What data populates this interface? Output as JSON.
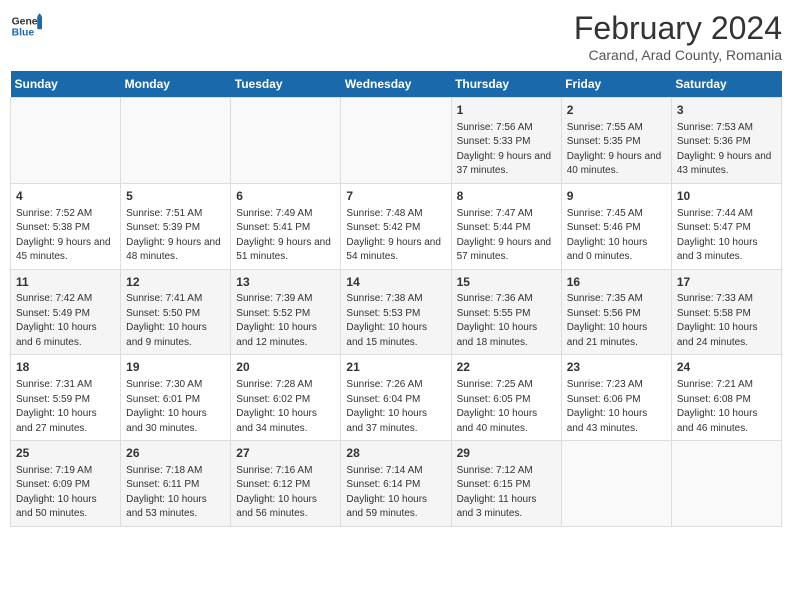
{
  "logo": {
    "general": "General",
    "blue": "Blue"
  },
  "title": "February 2024",
  "subtitle": "Carand, Arad County, Romania",
  "days_of_week": [
    "Sunday",
    "Monday",
    "Tuesday",
    "Wednesday",
    "Thursday",
    "Friday",
    "Saturday"
  ],
  "weeks": [
    [
      {
        "day": "",
        "sunrise": "",
        "sunset": "",
        "daylight": ""
      },
      {
        "day": "",
        "sunrise": "",
        "sunset": "",
        "daylight": ""
      },
      {
        "day": "",
        "sunrise": "",
        "sunset": "",
        "daylight": ""
      },
      {
        "day": "",
        "sunrise": "",
        "sunset": "",
        "daylight": ""
      },
      {
        "day": "1",
        "sunrise": "Sunrise: 7:56 AM",
        "sunset": "Sunset: 5:33 PM",
        "daylight": "Daylight: 9 hours and 37 minutes."
      },
      {
        "day": "2",
        "sunrise": "Sunrise: 7:55 AM",
        "sunset": "Sunset: 5:35 PM",
        "daylight": "Daylight: 9 hours and 40 minutes."
      },
      {
        "day": "3",
        "sunrise": "Sunrise: 7:53 AM",
        "sunset": "Sunset: 5:36 PM",
        "daylight": "Daylight: 9 hours and 43 minutes."
      }
    ],
    [
      {
        "day": "4",
        "sunrise": "Sunrise: 7:52 AM",
        "sunset": "Sunset: 5:38 PM",
        "daylight": "Daylight: 9 hours and 45 minutes."
      },
      {
        "day": "5",
        "sunrise": "Sunrise: 7:51 AM",
        "sunset": "Sunset: 5:39 PM",
        "daylight": "Daylight: 9 hours and 48 minutes."
      },
      {
        "day": "6",
        "sunrise": "Sunrise: 7:49 AM",
        "sunset": "Sunset: 5:41 PM",
        "daylight": "Daylight: 9 hours and 51 minutes."
      },
      {
        "day": "7",
        "sunrise": "Sunrise: 7:48 AM",
        "sunset": "Sunset: 5:42 PM",
        "daylight": "Daylight: 9 hours and 54 minutes."
      },
      {
        "day": "8",
        "sunrise": "Sunrise: 7:47 AM",
        "sunset": "Sunset: 5:44 PM",
        "daylight": "Daylight: 9 hours and 57 minutes."
      },
      {
        "day": "9",
        "sunrise": "Sunrise: 7:45 AM",
        "sunset": "Sunset: 5:46 PM",
        "daylight": "Daylight: 10 hours and 0 minutes."
      },
      {
        "day": "10",
        "sunrise": "Sunrise: 7:44 AM",
        "sunset": "Sunset: 5:47 PM",
        "daylight": "Daylight: 10 hours and 3 minutes."
      }
    ],
    [
      {
        "day": "11",
        "sunrise": "Sunrise: 7:42 AM",
        "sunset": "Sunset: 5:49 PM",
        "daylight": "Daylight: 10 hours and 6 minutes."
      },
      {
        "day": "12",
        "sunrise": "Sunrise: 7:41 AM",
        "sunset": "Sunset: 5:50 PM",
        "daylight": "Daylight: 10 hours and 9 minutes."
      },
      {
        "day": "13",
        "sunrise": "Sunrise: 7:39 AM",
        "sunset": "Sunset: 5:52 PM",
        "daylight": "Daylight: 10 hours and 12 minutes."
      },
      {
        "day": "14",
        "sunrise": "Sunrise: 7:38 AM",
        "sunset": "Sunset: 5:53 PM",
        "daylight": "Daylight: 10 hours and 15 minutes."
      },
      {
        "day": "15",
        "sunrise": "Sunrise: 7:36 AM",
        "sunset": "Sunset: 5:55 PM",
        "daylight": "Daylight: 10 hours and 18 minutes."
      },
      {
        "day": "16",
        "sunrise": "Sunrise: 7:35 AM",
        "sunset": "Sunset: 5:56 PM",
        "daylight": "Daylight: 10 hours and 21 minutes."
      },
      {
        "day": "17",
        "sunrise": "Sunrise: 7:33 AM",
        "sunset": "Sunset: 5:58 PM",
        "daylight": "Daylight: 10 hours and 24 minutes."
      }
    ],
    [
      {
        "day": "18",
        "sunrise": "Sunrise: 7:31 AM",
        "sunset": "Sunset: 5:59 PM",
        "daylight": "Daylight: 10 hours and 27 minutes."
      },
      {
        "day": "19",
        "sunrise": "Sunrise: 7:30 AM",
        "sunset": "Sunset: 6:01 PM",
        "daylight": "Daylight: 10 hours and 30 minutes."
      },
      {
        "day": "20",
        "sunrise": "Sunrise: 7:28 AM",
        "sunset": "Sunset: 6:02 PM",
        "daylight": "Daylight: 10 hours and 34 minutes."
      },
      {
        "day": "21",
        "sunrise": "Sunrise: 7:26 AM",
        "sunset": "Sunset: 6:04 PM",
        "daylight": "Daylight: 10 hours and 37 minutes."
      },
      {
        "day": "22",
        "sunrise": "Sunrise: 7:25 AM",
        "sunset": "Sunset: 6:05 PM",
        "daylight": "Daylight: 10 hours and 40 minutes."
      },
      {
        "day": "23",
        "sunrise": "Sunrise: 7:23 AM",
        "sunset": "Sunset: 6:06 PM",
        "daylight": "Daylight: 10 hours and 43 minutes."
      },
      {
        "day": "24",
        "sunrise": "Sunrise: 7:21 AM",
        "sunset": "Sunset: 6:08 PM",
        "daylight": "Daylight: 10 hours and 46 minutes."
      }
    ],
    [
      {
        "day": "25",
        "sunrise": "Sunrise: 7:19 AM",
        "sunset": "Sunset: 6:09 PM",
        "daylight": "Daylight: 10 hours and 50 minutes."
      },
      {
        "day": "26",
        "sunrise": "Sunrise: 7:18 AM",
        "sunset": "Sunset: 6:11 PM",
        "daylight": "Daylight: 10 hours and 53 minutes."
      },
      {
        "day": "27",
        "sunrise": "Sunrise: 7:16 AM",
        "sunset": "Sunset: 6:12 PM",
        "daylight": "Daylight: 10 hours and 56 minutes."
      },
      {
        "day": "28",
        "sunrise": "Sunrise: 7:14 AM",
        "sunset": "Sunset: 6:14 PM",
        "daylight": "Daylight: 10 hours and 59 minutes."
      },
      {
        "day": "29",
        "sunrise": "Sunrise: 7:12 AM",
        "sunset": "Sunset: 6:15 PM",
        "daylight": "Daylight: 11 hours and 3 minutes."
      },
      {
        "day": "",
        "sunrise": "",
        "sunset": "",
        "daylight": ""
      },
      {
        "day": "",
        "sunrise": "",
        "sunset": "",
        "daylight": ""
      }
    ]
  ]
}
